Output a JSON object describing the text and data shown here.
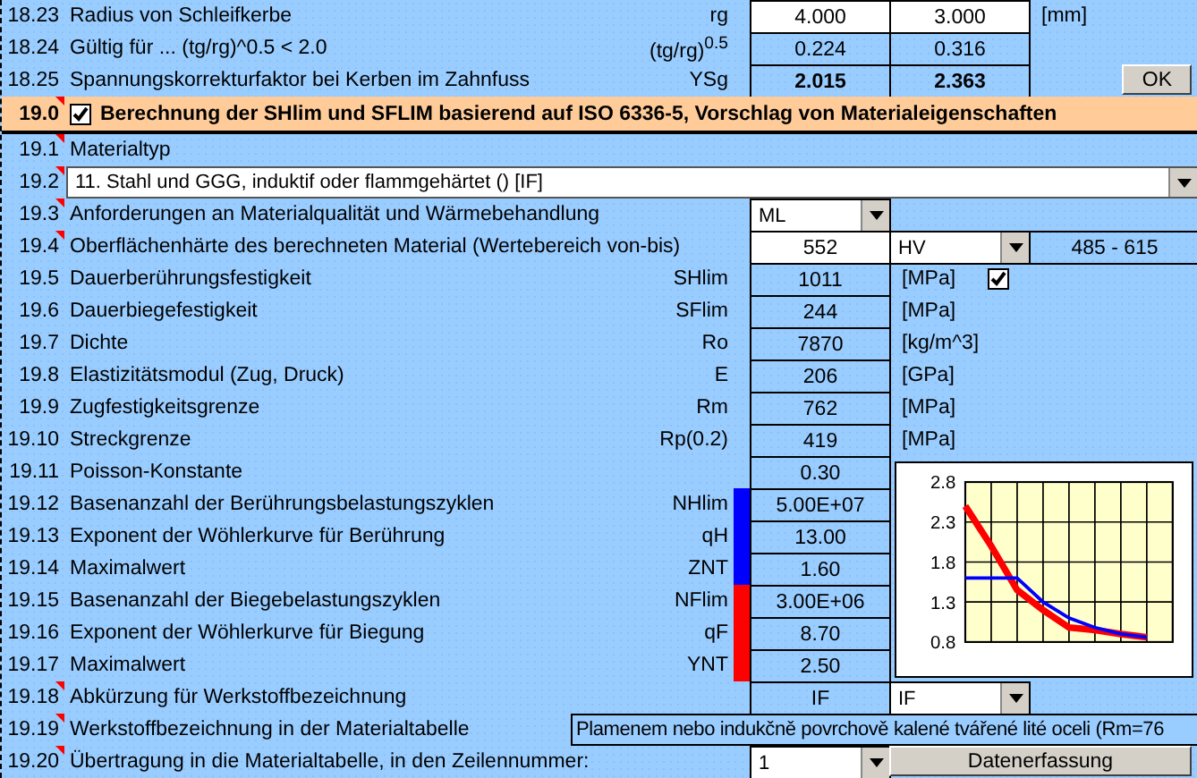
{
  "rows": [
    {
      "kind": "data",
      "num": "18.23",
      "comment": false,
      "label": "Radius von Schleifkerbe",
      "symbol": "rg",
      "cells": [
        {
          "kind": "input",
          "text": "4.000"
        },
        {
          "kind": "input",
          "text": "3.000"
        },
        {
          "kind": "unit",
          "text": "[mm]"
        }
      ]
    },
    {
      "kind": "data",
      "num": "18.24",
      "comment": false,
      "label": "Gültig für ... (tg/rg)^0.5 < 2.0",
      "symbol": "(tg/rg)$^{0.5}$",
      "cells": [
        {
          "kind": "output",
          "text": "0.224"
        },
        {
          "kind": "output",
          "text": "0.316"
        }
      ]
    },
    {
      "kind": "data",
      "num": "18.25",
      "comment": false,
      "label": "Spannungskorrekturfaktor bei Kerben im Zahnfuss",
      "symbol": "YSg",
      "cells": [
        {
          "kind": "output_bold",
          "text": "2.015"
        },
        {
          "kind": "output_bold",
          "text": "2.363"
        },
        {
          "kind": "button",
          "text": "OK"
        }
      ]
    },
    {
      "kind": "section",
      "num": "19.0",
      "comment": true,
      "checked": true,
      "label": "Berechnung der SHlim und SFLIM basierend auf ISO 6336-5, Vorschlag von Materialeigenschaften"
    },
    {
      "kind": "data",
      "num": "19.1",
      "comment": true,
      "label": "Materialtyp"
    },
    {
      "kind": "wide_dropdown",
      "num": "19.2",
      "comment": true,
      "value": "11. Stahl und GGG, induktif oder flammgehärtet () [IF]"
    },
    {
      "kind": "data",
      "num": "19.3",
      "comment": true,
      "label": "Anforderungen an Materialqualität und Wärmebehandlung",
      "cells": [
        {
          "kind": "dropdown",
          "text": "ML"
        }
      ]
    },
    {
      "kind": "data",
      "num": "19.4",
      "comment": true,
      "label": "Oberflächenhärte des berechneten Material (Wertebereich von-bis)",
      "cells": [
        {
          "kind": "input",
          "text": "552"
        },
        {
          "kind": "dropdown",
          "text": "HV"
        },
        {
          "kind": "output",
          "text": "485 - 615"
        }
      ]
    },
    {
      "kind": "data",
      "num": "19.5",
      "comment": false,
      "label": "Dauerberührungsfestigkeit",
      "symbol": "SHlim",
      "cells": [
        {
          "kind": "output",
          "text": "1011"
        },
        {
          "kind": "unit_check",
          "text": "[MPa]",
          "checked": true
        }
      ]
    },
    {
      "kind": "data",
      "num": "19.6",
      "comment": false,
      "label": "Dauerbiegefestigkeit",
      "symbol": "SFlim",
      "cells": [
        {
          "kind": "output",
          "text": "244"
        },
        {
          "kind": "unit",
          "text": "[MPa]"
        }
      ]
    },
    {
      "kind": "data",
      "num": "19.7",
      "comment": false,
      "label": "Dichte",
      "symbol": "Ro",
      "cells": [
        {
          "kind": "output",
          "text": "7870"
        },
        {
          "kind": "unit",
          "text": "[kg/m^3]"
        }
      ]
    },
    {
      "kind": "data",
      "num": "19.8",
      "comment": false,
      "label": "Elastizitätsmodul (Zug, Druck)",
      "symbol": "E",
      "cells": [
        {
          "kind": "output",
          "text": "206"
        },
        {
          "kind": "unit",
          "text": "[GPa]"
        }
      ]
    },
    {
      "kind": "data",
      "num": "19.9",
      "comment": false,
      "label": "Zugfestigkeitsgrenze",
      "symbol": "Rm",
      "cells": [
        {
          "kind": "output",
          "text": "762"
        },
        {
          "kind": "unit",
          "text": "[MPa]"
        }
      ]
    },
    {
      "kind": "data",
      "num": "19.10",
      "comment": false,
      "label": "Streckgrenze",
      "symbol": "Rp(0.2)",
      "cells": [
        {
          "kind": "output",
          "text": "419"
        },
        {
          "kind": "unit",
          "text": "[MPa]"
        }
      ]
    },
    {
      "kind": "data",
      "num": "19.11",
      "comment": false,
      "label": "Poisson-Konstante",
      "cells": [
        {
          "kind": "output",
          "text": "0.30"
        }
      ]
    },
    {
      "kind": "data",
      "num": "19.12",
      "comment": false,
      "label": "Basenanzahl der Berührungsbelastungszyklen",
      "symbol": "NHlim",
      "color": "#0000ff",
      "cells": [
        {
          "kind": "output",
          "text": "5.00E+07"
        }
      ]
    },
    {
      "kind": "data",
      "num": "19.13",
      "comment": false,
      "label": "Exponent der Wöhlerkurve für Berührung",
      "symbol": "qH",
      "color": "#0000ff",
      "cells": [
        {
          "kind": "output",
          "text": "13.00"
        }
      ]
    },
    {
      "kind": "data",
      "num": "19.14",
      "comment": false,
      "label": "Maximalwert",
      "symbol": "ZNT",
      "color": "#0000ff",
      "cells": [
        {
          "kind": "output",
          "text": "1.60"
        }
      ]
    },
    {
      "kind": "data",
      "num": "19.15",
      "comment": false,
      "label": "Basenanzahl der Biegebelastungszyklen",
      "symbol": "NFlim",
      "color": "#ff0000",
      "cells": [
        {
          "kind": "output",
          "text": "3.00E+06"
        }
      ]
    },
    {
      "kind": "data",
      "num": "19.16",
      "comment": false,
      "label": "Exponent der Wöhlerkurve für Biegung",
      "symbol": "qF",
      "color": "#ff0000",
      "cells": [
        {
          "kind": "output",
          "text": "8.70"
        }
      ]
    },
    {
      "kind": "data",
      "num": "19.17",
      "comment": false,
      "label": "Maximalwert",
      "symbol": "YNT",
      "color": "#ff0000",
      "cells": [
        {
          "kind": "output",
          "text": "2.50"
        }
      ]
    },
    {
      "kind": "data",
      "num": "19.18",
      "comment": true,
      "label": "Abkürzung für Werkstoffbezeichnung",
      "cells": [
        {
          "kind": "output",
          "text": "IF"
        },
        {
          "kind": "dropdown",
          "text": "IF"
        }
      ]
    },
    {
      "kind": "wide_text",
      "num": "19.19",
      "comment": true,
      "label": "Werkstoffbezeichnung in der Materialtabelle",
      "value": "Plamenem nebo indukčně povrchově kalené tvářené lité oceli (Rm=76"
    },
    {
      "kind": "data",
      "num": "19.20",
      "comment": true,
      "label": "Übertragung in die Materialtabelle, in den Zeilennummer:",
      "cells": [
        {
          "kind": "dropdown",
          "text": "1"
        },
        {
          "kind": "button_wide",
          "text": "Datenerfassung"
        }
      ]
    }
  ],
  "chart_data": {
    "type": "line",
    "grid": true,
    "ylim": [
      0.8,
      2.8
    ],
    "yticks": [
      0.8,
      1.3,
      1.8,
      2.3,
      2.8
    ],
    "series": [
      {
        "color": "#ff0000",
        "values": [
          2.5,
          2.0,
          1.45,
          1.2,
          0.98,
          0.95,
          0.9,
          0.86,
          null
        ]
      },
      {
        "color": "#0000ff",
        "values": [
          1.6,
          1.6,
          1.6,
          1.3,
          1.1,
          0.98,
          0.9,
          0.86,
          null
        ]
      }
    ]
  }
}
